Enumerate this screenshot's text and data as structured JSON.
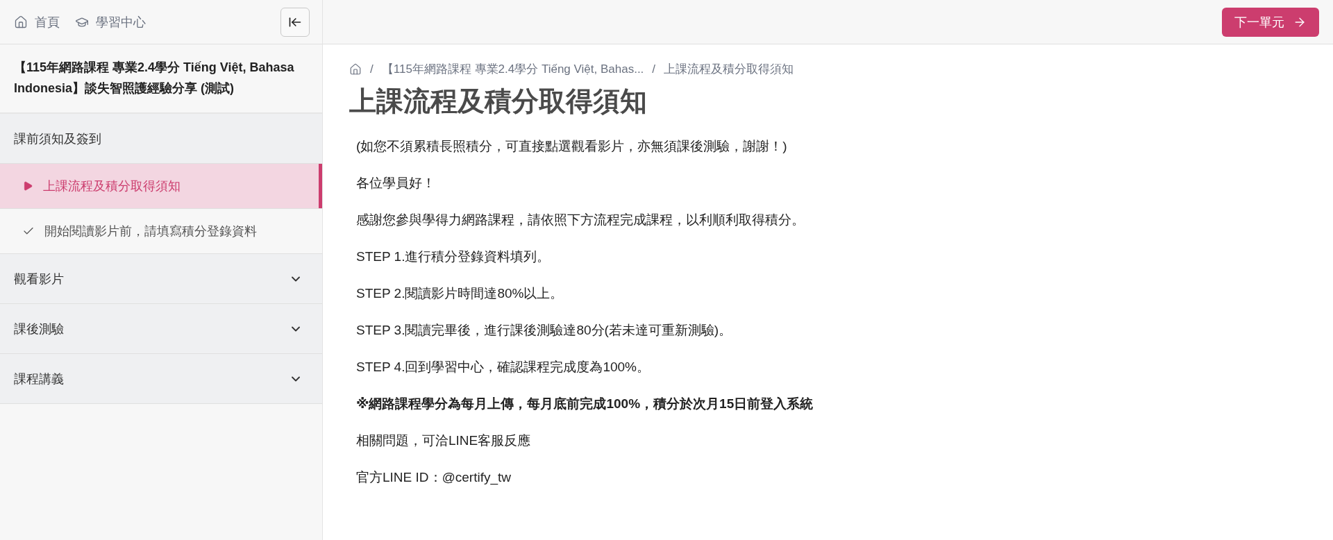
{
  "topnav": {
    "links": [
      {
        "label": "首頁"
      },
      {
        "label": "學習中心"
      }
    ]
  },
  "next_button": {
    "label": "下一單元"
  },
  "course_title": "【115年網路課程 專業2.4學分 Tiếng Việt, Bahasa Indonesia】談失智照護經驗分享 (測試)",
  "sections": [
    {
      "title": "課前須知及簽到",
      "expanded": true,
      "items": [
        {
          "label": "上課流程及積分取得須知",
          "kind": "current",
          "selected": true
        },
        {
          "label": "開始閱讀影片前，請填寫積分登錄資料",
          "kind": "done",
          "selected": false
        }
      ]
    },
    {
      "title": "觀看影片",
      "expanded": false
    },
    {
      "title": "課後測驗",
      "expanded": false
    },
    {
      "title": "課程講義",
      "expanded": false
    }
  ],
  "breadcrumb": [
    {
      "separator": "/",
      "label": "【115年網路課程 專業2.4學分 Tiếng Việt, Bahas..."
    },
    {
      "separator": "/",
      "label": "上課流程及積分取得須知"
    }
  ],
  "page_title": "上課流程及積分取得須知",
  "paragraphs": [
    {
      "text": "(如您不須累積長照積分，可直接點選觀看影片，亦無須課後測驗，謝謝！)",
      "bold": false
    },
    {
      "text": "各位學員好！",
      "bold": false
    },
    {
      "text": "感謝您參與學得力網路課程，請依照下方流程完成課程，以利順利取得積分。",
      "bold": false
    },
    {
      "text": "STEP 1.進行積分登錄資料填列。",
      "bold": false
    },
    {
      "text": "STEP 2.閱讀影片時間達80%以上。",
      "bold": false
    },
    {
      "text": "STEP 3.閱讀完畢後，進行課後測驗達80分(若未達可重新測驗)。",
      "bold": false
    },
    {
      "text": "STEP 4.回到學習中心，確認課程完成度為100%。",
      "bold": false
    },
    {
      "text": "※網路課程學分為每月上傳，每月底前完成100%，積分於次月15日前登入系統",
      "bold": true
    },
    {
      "text": "相關問題，可洽LINE客服反應",
      "bold": false
    },
    {
      "text": "官方LINE ID：@certify_tw",
      "bold": false
    }
  ]
}
